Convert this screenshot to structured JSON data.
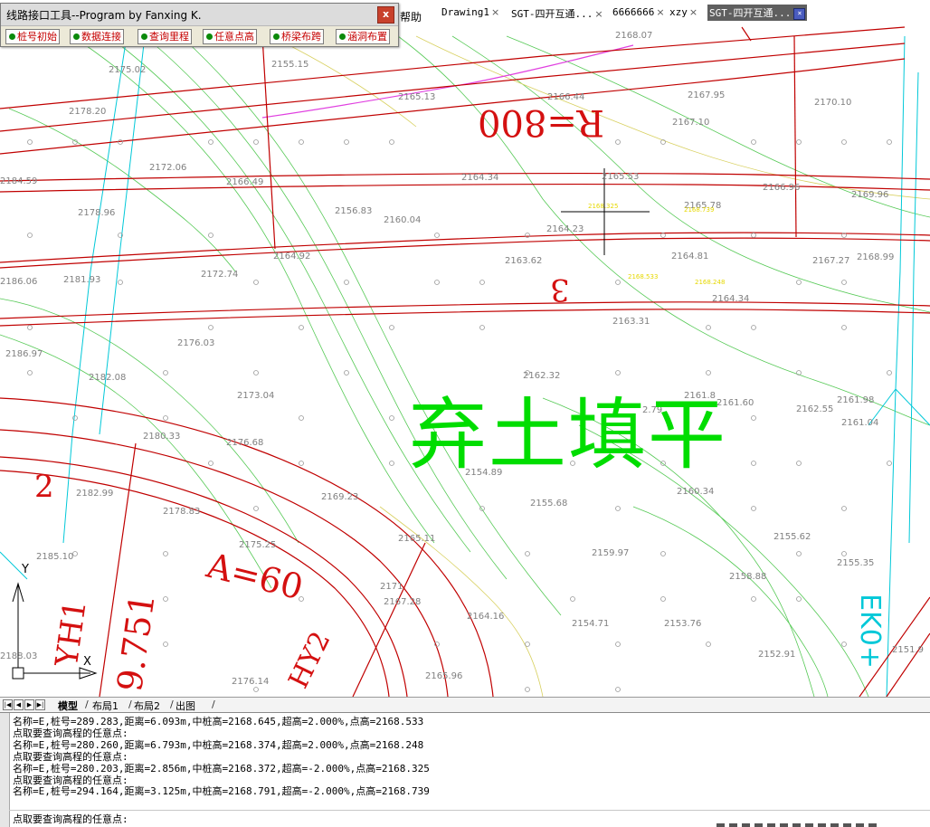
{
  "tool_window": {
    "title": "线路接口工具--Program by Fanxing K.",
    "close_label": "x",
    "buttons": [
      {
        "label": "桩号初始"
      },
      {
        "label": "数据连接"
      },
      {
        "label": "查询里程"
      },
      {
        "label": "任意点高"
      },
      {
        "label": "桥梁布跨"
      },
      {
        "label": "涵洞布置"
      }
    ]
  },
  "menu": {
    "help_label": "帮助"
  },
  "doc_tabs": [
    {
      "label": "Drawing1",
      "close": "×"
    },
    {
      "label": "SGT-四开互通...",
      "close": "×"
    },
    {
      "label": "6666666",
      "close": "×"
    },
    {
      "label": "xzy",
      "close": "×"
    },
    {
      "label": "SGT-四开互通...",
      "close": "×",
      "active": true
    }
  ],
  "layout_tabs": {
    "nav": [
      "|◀",
      "◀",
      "▶",
      "▶|"
    ],
    "tabs": [
      "模型",
      "布局1",
      "布局2",
      "出图"
    ],
    "active": "模型"
  },
  "drawing": {
    "colors": {
      "road_red": "#c00000",
      "contour_green": "#55c955",
      "contour_yellow": "#d8d060",
      "cyan": "#00c8d8",
      "magenta": "#e040e0",
      "big_text_green": "#00dd00",
      "label_red": "#d41010",
      "spot_gray": "#888888",
      "label_yellow": "#e6d800",
      "cursor": "#000000"
    },
    "large_labels": {
      "radius": "R=800",
      "fill_note": "弃土填平",
      "curve_a": "A=60",
      "yh": "YH1",
      "hy": "HY2",
      "station": "9.751",
      "ek": "EK0+",
      "num2": "2",
      "num3": "3"
    },
    "elevations": [
      {
        "t": "2168.07"
      },
      {
        "t": "2175.02"
      },
      {
        "t": "2155.15"
      },
      {
        "t": "2165.13"
      },
      {
        "t": "2166.44"
      },
      {
        "t": "2167.95"
      },
      {
        "t": "2170.10"
      },
      {
        "t": "2167.10"
      },
      {
        "t": "2178.20"
      },
      {
        "t": "2172.06"
      },
      {
        "t": "2184.59"
      },
      {
        "t": "2166.49"
      },
      {
        "t": "2164.34"
      },
      {
        "t": "2165.53"
      },
      {
        "t": "2166.96"
      },
      {
        "t": "2169.96"
      },
      {
        "t": "2178.96"
      },
      {
        "t": "2156.83"
      },
      {
        "t": "2160.04"
      },
      {
        "t": "2165.78"
      },
      {
        "t": "2164.23"
      },
      {
        "t": "2164.92"
      },
      {
        "t": "2163.62"
      },
      {
        "t": "2164.81"
      },
      {
        "t": "2167.27"
      },
      {
        "t": "2168.99"
      },
      {
        "t": "2186.06"
      },
      {
        "t": "2181.93"
      },
      {
        "t": "2172.74"
      },
      {
        "t": "2164.34"
      },
      {
        "t": "2163.31"
      },
      {
        "t": "2176.03"
      },
      {
        "t": "2186.97"
      },
      {
        "t": "2182.08"
      },
      {
        "t": "2162.32"
      },
      {
        "t": "2173.04"
      },
      {
        "t": "2161.8"
      },
      {
        "t": "2161.60"
      },
      {
        "t": "2161.98"
      },
      {
        "t": "2162.55"
      },
      {
        "t": "2161.04"
      },
      {
        "t": "2180.33"
      },
      {
        "t": "2176.68"
      },
      {
        "t": "2.79"
      },
      {
        "t": "2154.89"
      },
      {
        "t": "2182.99"
      },
      {
        "t": "2169.23"
      },
      {
        "t": "2160.34"
      },
      {
        "t": "2178.83"
      },
      {
        "t": "2155.68"
      },
      {
        "t": "2185.10"
      },
      {
        "t": "2175.25"
      },
      {
        "t": "2155.62"
      },
      {
        "t": "2165.11"
      },
      {
        "t": "2159.97"
      },
      {
        "t": "2155.35"
      },
      {
        "t": "2158.88"
      },
      {
        "t": "2167.28"
      },
      {
        "t": "2164.16"
      },
      {
        "t": "2154.71"
      },
      {
        "t": "2153.76"
      },
      {
        "t": "2152.91"
      },
      {
        "t": "2188.03"
      },
      {
        "t": "2176.14"
      },
      {
        "t": "2165.96"
      },
      {
        "t": "2151.9"
      },
      {
        "t": "2171"
      }
    ],
    "yellow_labels": [
      {
        "t": "2168.533"
      },
      {
        "t": "2168.248"
      },
      {
        "t": "2168.325"
      },
      {
        "t": "2168.739"
      }
    ],
    "ucs": {
      "y": "Y",
      "x": "X"
    }
  },
  "command": {
    "history": [
      "名称=E,桩号=289.283,距离=6.093m,中桩高=2168.645,超高=2.000%,点高=2168.533",
      "点取要查询高程的任意点:",
      "名称=E,桩号=280.260,距离=6.793m,中桩高=2168.374,超高=2.000%,点高=2168.248",
      "点取要查询高程的任意点:",
      "名称=E,桩号=280.203,距离=2.856m,中桩高=2168.372,超高=-2.000%,点高=2168.325",
      "点取要查询高程的任意点:",
      "名称=E,桩号=294.164,距离=3.125m,中桩高=2168.791,超高=-2.000%,点高=2168.739"
    ],
    "prompt": "点取要查询高程的任意点:"
  }
}
